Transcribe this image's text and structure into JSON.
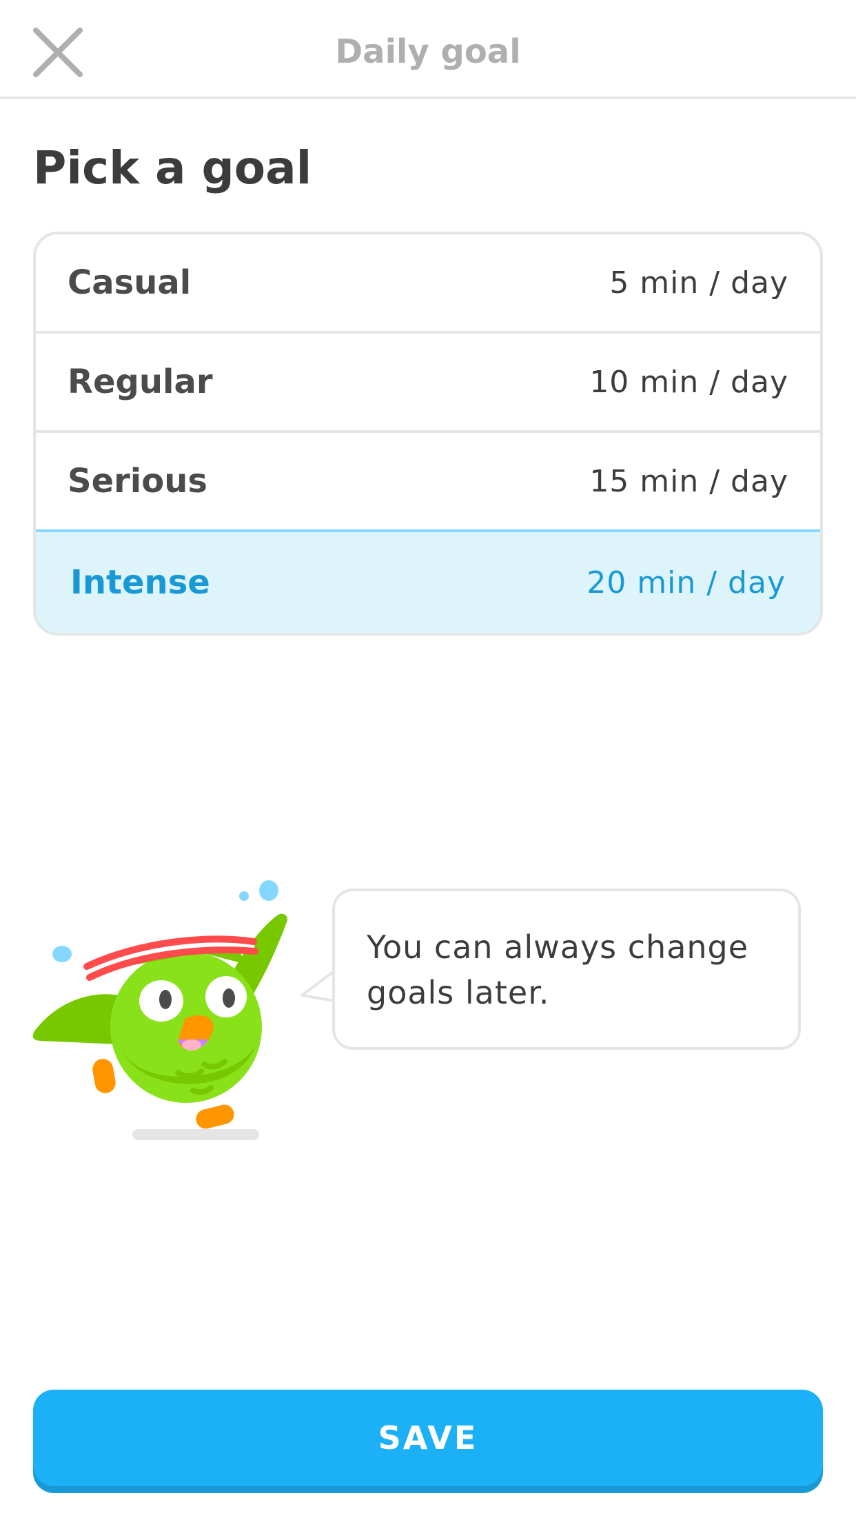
{
  "header": {
    "title": "Daily goal",
    "close_icon": "close-icon"
  },
  "page": {
    "title": "Pick a goal"
  },
  "goals": [
    {
      "name": "Casual",
      "time": "5 min / day",
      "selected": false
    },
    {
      "name": "Regular",
      "time": "10 min / day",
      "selected": false
    },
    {
      "name": "Serious",
      "time": "15 min / day",
      "selected": false
    },
    {
      "name": "Intense",
      "time": "20 min / day",
      "selected": true
    }
  ],
  "mascot": {
    "icon": "owl-mascot-icon",
    "bubble_text": "You can always change goals later."
  },
  "footer": {
    "save_label": "SAVE"
  },
  "colors": {
    "accent": "#1cb0f6",
    "accent_dark": "#1899d6",
    "selected_bg": "#ddf4fb",
    "selected_border": "#84d8ff",
    "owl_green": "#78c800"
  }
}
